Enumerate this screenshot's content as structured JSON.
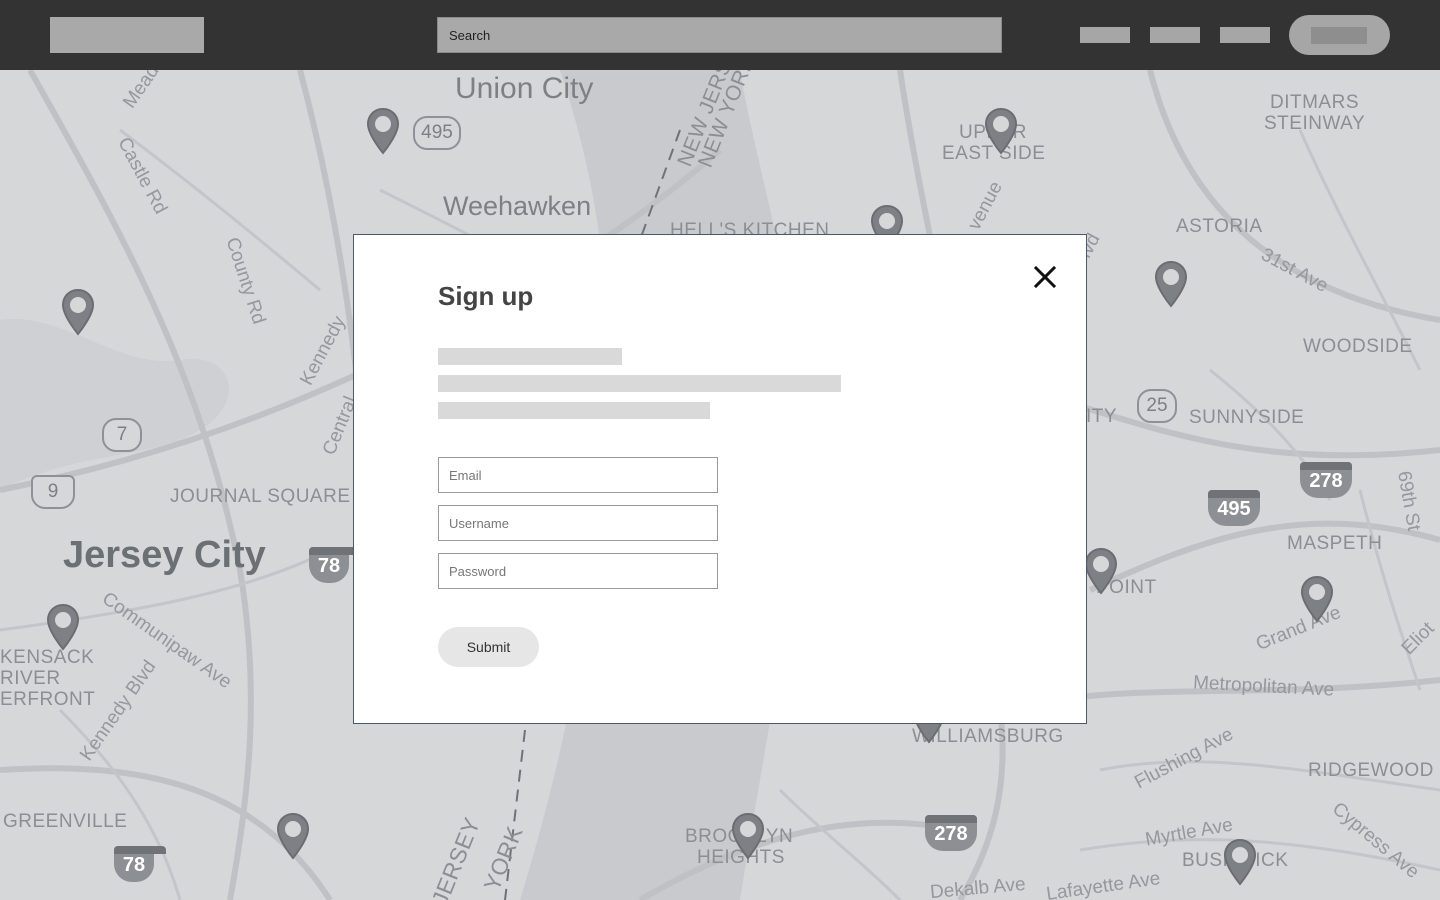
{
  "header": {
    "search_placeholder": "Search"
  },
  "map": {
    "labels": {
      "union_city": "Union City",
      "weehawken": "Weehawken",
      "jersey_city": "Jersey City",
      "journal_square": "JOURNAL SQUARE",
      "hells_kitchen": "HELL'S KITCHEN",
      "upper_east_side_1": "UPPER",
      "upper_east_side_2": "EAST SIDE",
      "ditmars_1": "DITMARS",
      "ditmars_2": "STEINWAY",
      "astoria": "ASTORIA",
      "woodside": "WOODSIDE",
      "sunnyside": "SUNNYSIDE",
      "maspeth": "MASPETH",
      "williamsburg": "WILLIAMSBURG",
      "ridgewood": "RIDGEWOOD",
      "bushwick": "BUSHWICK",
      "brooklyn_heights_1": "BROOKLYN",
      "brooklyn_heights_2": "HEIGHTS",
      "greenville": "GREENVILLE",
      "kensack_1": "KENSACK",
      "kensack_2": "RIVER",
      "kensack_3": "ERFRONT",
      "ity": "ITY",
      "point": "POINT",
      "castle_rd": "Castle Rd",
      "county_rd": "County Rd",
      "kennedy": "Kennedy",
      "central": "Central",
      "communipaw": "Communipaw Ave",
      "kennedy_blvd": "Kennedy Blvd",
      "first_ave": "31st Ave",
      "sixty_ninth": "69th St",
      "grand_ave": "Grand Ave",
      "metropolitan": "Metropolitan Ave",
      "flushing": "Flushing Ave",
      "myrtle": "Myrtle Ave",
      "cypress": "Cypress Ave",
      "dekalb": "Dekalb Ave",
      "lafayette": "Lafayette Ave",
      "new_jersey_top": "NEW JERSEY",
      "new_york_top": "NEW YORK",
      "jersey_bottom": "JERSEY",
      "york_bottom": "YORK",
      "venue": "venue",
      "blvd": "lvd",
      "mead": "Mead",
      "eliot": "Eliot"
    },
    "shields": {
      "r495": "495",
      "r7": "7",
      "r9": "9",
      "r25": "25",
      "i78a": "78",
      "i78b": "78",
      "i278a": "278",
      "i278b": "278",
      "i495": "495"
    }
  },
  "modal": {
    "title": "Sign up",
    "email_placeholder": "Email",
    "username_placeholder": "Username",
    "password_placeholder": "Password",
    "submit_label": "Submit"
  }
}
